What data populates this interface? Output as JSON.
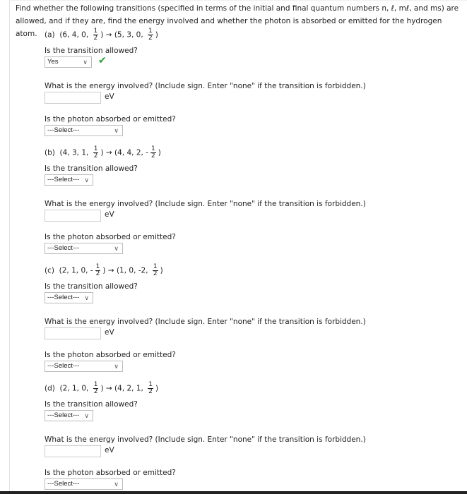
{
  "intro": {
    "line1": "Find whether the following transitions (specified in terms of the initial and final quantum numbers n, ℓ, mℓ, and ms) are",
    "line2": "allowed, and if they are, find the energy involved and whether the photon is absorbed or emitted for the hydrogen atom."
  },
  "common": {
    "allowed_q": "Is the transition allowed?",
    "energy_q": "What is the energy involved? (Include sign. Enter \"none\" if the transition is forbidden.)",
    "unit": "eV",
    "photon_q": "Is the photon absorbed or emitted?"
  },
  "parts": [
    {
      "label": "(a)",
      "initial": "(6, 4, 0,",
      "initial_sign": "",
      "final": "(5, 3, 0,",
      "final_sign": "",
      "allowed": "Yes",
      "allowed_correct": true,
      "energy": "",
      "photon": "---Select---"
    },
    {
      "label": "(b)",
      "initial": "(4, 3, 1,",
      "initial_sign": "",
      "final": "(4, 4, 2,",
      "final_sign": "-",
      "allowed": "---Select---",
      "energy": "",
      "photon": "---Select---"
    },
    {
      "label": "(c)",
      "initial": "(2, 1, 0,",
      "initial_sign": "-",
      "final": "(1, 0, -2,",
      "final_sign": "",
      "allowed": "---Select---",
      "energy": "",
      "photon": "---Select---"
    },
    {
      "label": "(d)",
      "initial": "(2, 1, 0,",
      "initial_sign": "",
      "final": "(4, 2, 1,",
      "final_sign": "",
      "allowed": "---Select---",
      "energy": "",
      "photon": "---Select---"
    }
  ],
  "fraction": {
    "num": "1",
    "den": "2"
  },
  "arrow": "→",
  "icons": {
    "check": "check-icon",
    "chevron": "chevron-down-icon"
  },
  "colors": {
    "check": "#2e9e3a"
  }
}
